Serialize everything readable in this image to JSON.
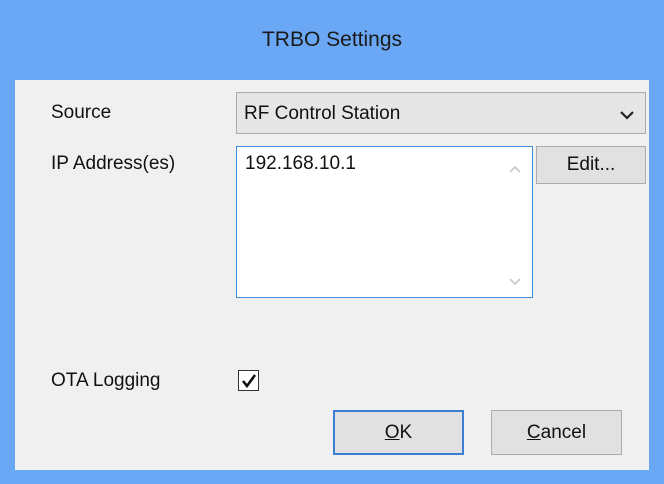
{
  "window": {
    "title": "TRBO Settings"
  },
  "form": {
    "source_label": "Source",
    "source_value": "RF Control Station",
    "ip_label": "IP Address(es)",
    "ip_addresses": [
      "192.168.10.1"
    ],
    "edit_button": "Edit...",
    "ota_label": "OTA Logging",
    "ota_checked": true
  },
  "buttons": {
    "ok_accel": "O",
    "ok_rest": "K",
    "cancel_accel": "C",
    "cancel_rest": "ancel"
  },
  "icons": {
    "combo_arrow": "chevron-down-icon",
    "scroll_up": "chevron-up-icon",
    "scroll_down": "chevron-down-icon",
    "check": "checkmark-icon"
  },
  "colors": {
    "titlebar": "#6aa7f5",
    "client": "#f0f0f0",
    "focus_border": "#3c7fd1"
  }
}
